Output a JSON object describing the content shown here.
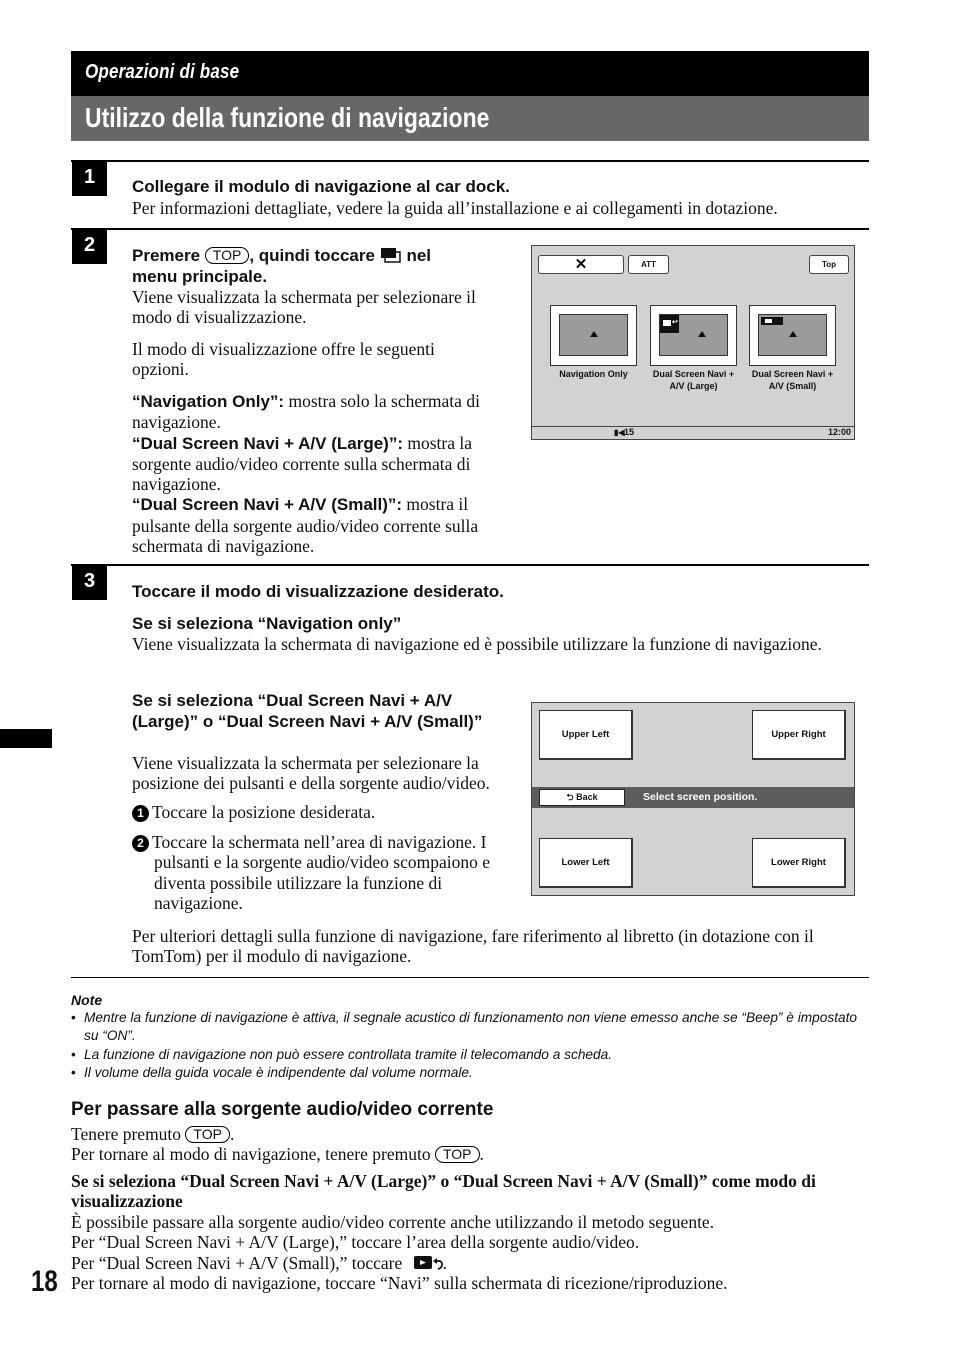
{
  "header": {
    "section": "Operazioni di base",
    "title": "Utilizzo della funzione di navigazione"
  },
  "steps": [
    {
      "number": "1",
      "heading": "Collegare il modulo di navigazione al car dock.",
      "body": "Per informazioni dettagliate, vedere la guida all’installazione e ai collegamenti in dotazione."
    },
    {
      "number": "2",
      "heading_pre": "Premere",
      "heading_key": "TOP",
      "heading_mid": ", quindi toccare",
      "heading_icon": "screen-mode-icon",
      "heading_post": "nel",
      "heading_line2": "menu principale.",
      "body1": "Viene visualizzata la schermata per selezionare il modo di visualizzazione.",
      "body2": "Il modo di visualizzazione offre le seguenti opzioni.",
      "options": [
        {
          "term": "“Navigation Only”:",
          "desc": "mostra solo la schermata di navigazione."
        },
        {
          "term": "“Dual Screen Navi + A/V (Large)”:",
          "desc": "mostra la sorgente audio/video corrente sulla schermata di navigazione."
        },
        {
          "term": "“Dual Screen Navi + A/V (Small)”:",
          "desc": "mostra il pulsante della sorgente audio/video corrente sulla schermata di navigazione."
        }
      ]
    },
    {
      "number": "3",
      "heading": "Toccare il modo di visualizzazione desiderato.",
      "sub1_heading": "Se si seleziona “Navigation only”",
      "sub1_body": "Viene visualizzata la schermata di navigazione ed è possibile utilizzare la funzione di navigazione.",
      "sub2_heading": "Se si seleziona “Dual Screen Navi + A/V (Large)” o “Dual Screen Navi + A/V (Small)”",
      "sub2_body": "Viene visualizzata la schermata per selezionare la posizione dei pulsanti e della sorgente audio/video.",
      "sub2_steps": [
        {
          "num": "1",
          "text": "Toccare la posizione desiderata."
        },
        {
          "num": "2",
          "text": "Toccare la schermata nell’area di navigazione. I pulsanti e la sorgente audio/video scompaiono e diventa possibile utilizzare la funzione di navigazione."
        }
      ],
      "footer": "Per ulteriori dettagli sulla funzione di navigazione, fare riferimento al libretto (in dotazione con il TomTom) per il modulo di navigazione."
    }
  ],
  "screen1": {
    "close_icon": "close-icon",
    "att_label": "ATT",
    "top_label": "Top",
    "modes": [
      {
        "label": "Navigation Only"
      },
      {
        "label": "Dual Screen Navi + A/V (Large)"
      },
      {
        "label": "Dual Screen Navi + A/V (Small)"
      }
    ],
    "volume_icon": "volume-icon",
    "volume": "15",
    "clock": "12:00"
  },
  "screen2": {
    "upper_left": "Upper Left",
    "upper_right": "Upper Right",
    "lower_left": "Lower Left",
    "lower_right": "Lower Right",
    "back_label": "Back",
    "back_icon": "back-arrow-icon",
    "prompt": "Select screen position."
  },
  "notes": {
    "title": "Note",
    "items": [
      "Mentre la funzione di navigazione è attiva, il segnale acustico di funzionamento non viene emesso anche se “Beep” è impostato su “ON”.",
      "La funzione di navigazione non può essere controllata tramite il telecomando a scheda.",
      "Il volume della guida vocale è indipendente dal volume normale."
    ]
  },
  "switch_section": {
    "heading": "Per passare alla sorgente audio/video corrente",
    "line1_pre": "Tenere premuto",
    "line1_key": "TOP",
    "line2_pre": "Per tornare al modo di navigazione, tenere premuto",
    "line2_key": "TOP",
    "sub_heading": "Se si seleziona “Dual Screen Navi + A/V (Large)” o “Dual Screen Navi + A/V (Small)” come modo di visualizzazione",
    "lines": [
      "È possibile passare alla sorgente audio/video corrente anche utilizzando il metodo seguente.",
      "Per “Dual Screen Navi + A/V (Large),” toccare l’area della sorgente audio/video."
    ],
    "small_pre": "Per “Dual Screen Navi + A/V (Small),” toccare",
    "small_icon": "av-source-icon",
    "last_line": "Per tornare al modo di navigazione, toccare “Navi” sulla schermata di ricezione/riproduzione."
  },
  "page_number": "18"
}
